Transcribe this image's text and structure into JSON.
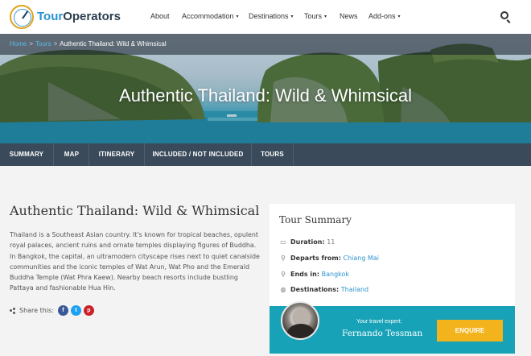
{
  "brand": {
    "name_part1": "Tour",
    "name_part2": "Operators"
  },
  "nav": {
    "items": [
      {
        "label": "About",
        "dropdown": false
      },
      {
        "label": "Accommodation",
        "dropdown": true
      },
      {
        "label": "Destinations",
        "dropdown": true
      },
      {
        "label": "Tours",
        "dropdown": true
      },
      {
        "label": "News",
        "dropdown": false
      },
      {
        "label": "Add-ons",
        "dropdown": true
      }
    ],
    "caret": "▾"
  },
  "breadcrumb": {
    "home": "Home",
    "tours": "Tours",
    "current": "Authentic Thailand: Wild & Whimsical",
    "separator": ">"
  },
  "hero": {
    "title": "Authentic Thailand: Wild & Whimsical"
  },
  "tabs": [
    "SUMMARY",
    "MAP",
    "ITINERARY",
    "INCLUDED / NOT INCLUDED",
    "TOURS"
  ],
  "content": {
    "title": "Authentic Thailand: Wild & Whimsical",
    "description_lines": [
      "Thailand is a Southeast Asian country. It's known for tropical beaches, opulent",
      "royal palaces, ancient ruins and ornate temples displaying figures of Buddha.",
      "In Bangkok, the capital, an ultramodern cityscape rises next to quiet canalside",
      "communities and the iconic temples of Wat Arun, Wat Pho and the Emerald",
      "Buddha Temple (Wat Phra Kaew). Nearby beach resorts include bustling",
      "Pattaya and fashionable Hua Hin."
    ],
    "share_label": "Share this:",
    "social": [
      {
        "name": "facebook",
        "glyph": "f",
        "color": "#3b5998"
      },
      {
        "name": "twitter",
        "glyph": "t",
        "color": "#1da1f2"
      },
      {
        "name": "pinterest",
        "glyph": "p",
        "color": "#cb2027"
      }
    ]
  },
  "summary": {
    "title": "Tour Summary",
    "duration_label": "Duration:",
    "duration_value": "11",
    "departs_label": "Departs from:",
    "departs_value": "Chiang Mai",
    "ends_label": "Ends in:",
    "ends_value": "Bangkok",
    "destinations_label": "Destinations:",
    "destinations_value": "Thailand"
  },
  "expert": {
    "label": "Your travel expert:",
    "name": "Fernando Tessman",
    "button": "ENQUIRE"
  },
  "colors": {
    "brand_blue": "#2a93cf",
    "tabbar": "#3a4a5a",
    "expert_bg": "#17a2b8",
    "enquire": "#f2b31d"
  }
}
